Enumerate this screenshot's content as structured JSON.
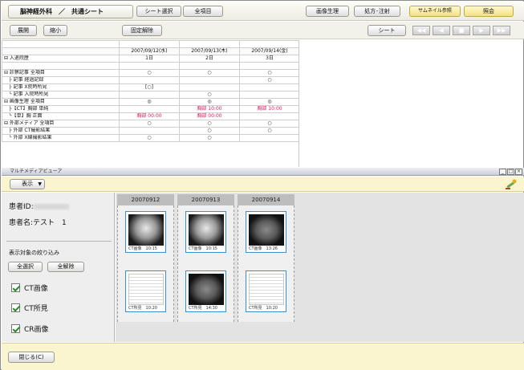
{
  "header": {
    "department": "脳神経外科",
    "separator": "／",
    "sheet_name": "共通シート",
    "buttons": {
      "sheet_select": "シート選択",
      "all_items": "全項目",
      "image_viewer": "画像生理",
      "prescription": "処方･注射",
      "thumbnail": "サムネイル参照",
      "consult": "照会"
    }
  },
  "toolbar2": {
    "expand": "展開",
    "collapse": "縮小",
    "unfix": "固定解除",
    "sheet": "シート",
    "nav": [
      "◀◀",
      "◀",
      "■",
      "▶",
      "▶▶"
    ]
  },
  "table": {
    "dates": [
      "2007/09/12(水)",
      "2007/09/13(木)",
      "2007/09/14(金)"
    ],
    "rows": [
      {
        "label": "⊟ 入退院歴",
        "cells": [
          "1日",
          "2日",
          "3日"
        ]
      },
      {
        "label": "",
        "cells": [
          "",
          "",
          ""
        ]
      },
      {
        "label": "⊟ 診察記事 全項目",
        "cells": [
          "○",
          "○",
          "○"
        ]
      },
      {
        "label": "　├ 記事 経過記録",
        "cells": [
          "",
          "",
          "○"
        ]
      },
      {
        "label": "　├ 記事 X院時所見",
        "cells": [
          "[○]",
          "",
          ""
        ]
      },
      {
        "label": "　└ 記事 入院時所見",
        "cells": [
          "",
          "○",
          ""
        ]
      },
      {
        "label": "⊟ 画像生理 全項目",
        "cells": [
          "◎",
          "◎",
          "◎"
        ]
      },
      {
        "label": "　├【CT】胸部 単純",
        "cells": [
          "",
          "胸部 10:00",
          "胸部 10:00"
        ]
      },
      {
        "label": "　└【単】胸 正面",
        "cells": [
          "胸部 00:00",
          "胸部 00:00",
          ""
        ]
      },
      {
        "label": "⊟ 外部メディア 全項目",
        "cells": [
          "○",
          "○",
          "○"
        ]
      },
      {
        "label": "　├ 外部 CT撮影結果",
        "cells": [
          "",
          "○",
          "○"
        ]
      },
      {
        "label": "　└ 外部 X線撮影結果",
        "cells": [
          "○",
          "○",
          ""
        ]
      }
    ]
  },
  "viewer": {
    "title": "マルチメディアビューア",
    "window_buttons": [
      "_",
      "□",
      "×"
    ],
    "display_menu": "表示",
    "patient_id_label": "患者ID:",
    "patient_name_label": "患者名:テスト　1",
    "filter_title": "表示対象の絞り込み",
    "select_all": "全選択",
    "deselect_all": "全解除",
    "filters": [
      "CT画像",
      "CT所見",
      "CR画像"
    ],
    "columns": [
      "20070912",
      "20070913",
      "20070914"
    ],
    "thumbs": [
      {
        "caption": "CT画像　10:15",
        "kind": "xray"
      },
      {
        "caption": "CT画像　10:15",
        "kind": "xray"
      },
      {
        "caption": "CT画像　13:26",
        "kind": "ct"
      },
      {
        "caption": "CT所見　10:20",
        "kind": "doc"
      },
      {
        "caption": "CT所見　14:30",
        "kind": "ct"
      },
      {
        "caption": "CT所見　10:20",
        "kind": "doc"
      }
    ],
    "close_button": "閉じる(C)"
  }
}
